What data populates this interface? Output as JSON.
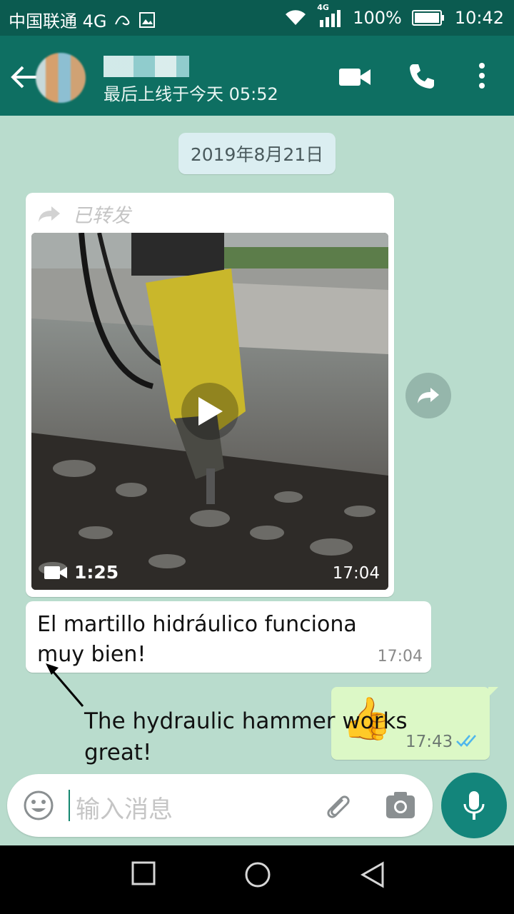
{
  "status_bar": {
    "carrier": "中国联通 4G",
    "network": "4G",
    "battery": "100%",
    "time": "10:42"
  },
  "chat_header": {
    "last_seen": "最后上线于今天 05:52"
  },
  "date_chip": "2019年8月21日",
  "messages": {
    "forwarded_label": "已转发",
    "video_duration": "1:25",
    "video_time": "17:04",
    "text_message": "El martillo hidráulico funciona muy bien!",
    "text_time": "17:04",
    "outgoing_emoji": "👍",
    "outgoing_time": "17:43"
  },
  "annotation": "The hydraulic hammer works great!",
  "composer": {
    "placeholder": "输入消息"
  },
  "colors": {
    "header": "#0e6f62",
    "chat_bg": "#b9dccd",
    "outgoing_bubble": "#dcf8c6",
    "mic_button": "#13857b"
  }
}
